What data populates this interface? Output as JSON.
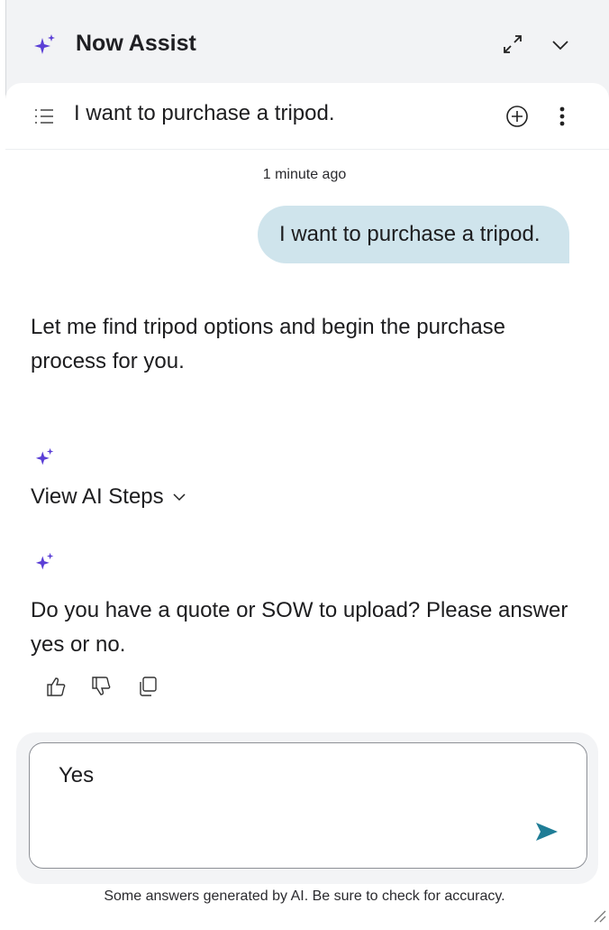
{
  "header": {
    "title": "Now Assist"
  },
  "conversation": {
    "title": "I want to purchase a tripod.",
    "timestamp": "1 minute ago",
    "user_message": "I want to purchase a tripod.",
    "assistant_message_1": "Let me find tripod options and begin the purchase process for you.",
    "view_steps_label": "View AI Steps",
    "assistant_message_2": "Do you have a quote or SOW to upload? Please answer yes or no."
  },
  "composer": {
    "value": "Yes"
  },
  "footer": {
    "disclaimer": "Some answers generated by AI. Be sure to check for accuracy."
  },
  "icons": {
    "sparkle": "sparkle-icon",
    "expand": "expand-icon",
    "collapse": "chevron-down-icon",
    "list": "list-icon",
    "new_chat": "plus-circle-icon",
    "more": "more-vertical-icon",
    "thumbs_up": "thumbs-up-icon",
    "thumbs_down": "thumbs-down-icon",
    "copy": "copy-icon",
    "send": "send-icon"
  },
  "colors": {
    "sparkle": "#5b3fd6",
    "user_bubble": "#cfe4ec",
    "send": "#1f7d96"
  }
}
